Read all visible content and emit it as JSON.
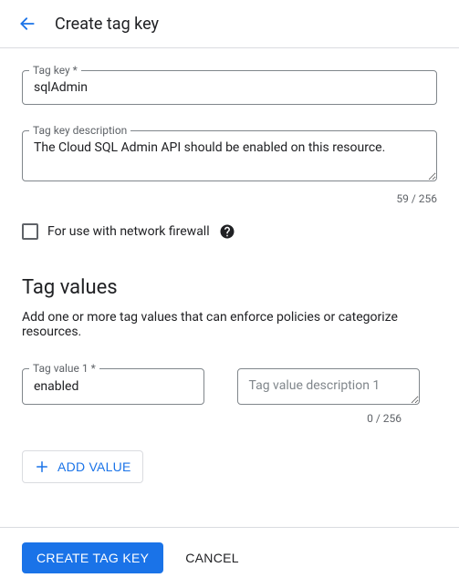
{
  "header": {
    "title": "Create tag key"
  },
  "form": {
    "tag_key_label": "Tag key *",
    "tag_key_value": "sqlAdmin",
    "tag_key_desc_label": "Tag key description",
    "tag_key_desc_value": "The Cloud SQL Admin API should be enabled on this resource.",
    "tag_key_desc_count": "59 / 256",
    "firewall_label": "For use with network firewall"
  },
  "tag_values": {
    "title": "Tag values",
    "desc": "Add one or more tag values that can enforce policies or categorize resources.",
    "value1_label": "Tag value 1 *",
    "value1_value": "enabled",
    "value1_desc_placeholder": "Tag value description 1",
    "value1_desc_count": "0 / 256",
    "add_value_label": "ADD VALUE"
  },
  "footer": {
    "create_label": "CREATE TAG KEY",
    "cancel_label": "CANCEL"
  }
}
